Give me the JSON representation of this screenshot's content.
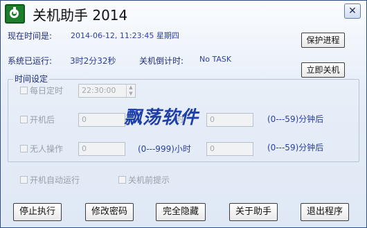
{
  "window": {
    "title": "关机助手 2014",
    "close_glyph": "✕"
  },
  "status": {
    "current_time_label": "现在时间是:",
    "current_time_value": "2014-06-12, 11:23:45  星期四",
    "uptime_label": "系统已运行:",
    "uptime_value": "3时2分32秒",
    "countdown_label": "关机倒计时:",
    "countdown_value": "No TASK"
  },
  "side_buttons": {
    "protect": "保护进程",
    "shutdown_now": "立即关机"
  },
  "time_settings": {
    "group_title": "时间设定",
    "daily": {
      "label": "每日定时",
      "value": "22:30:00"
    },
    "after": {
      "label": "开机后",
      "value": "0",
      "value2": "0",
      "range": "(0---59)分钟后"
    },
    "idle": {
      "label": "无人操作",
      "value": "0",
      "range": "(0---999)小时",
      "value2": "0",
      "range2": "(0---59)分钟后"
    },
    "hidden_hour_char": "时"
  },
  "options": {
    "autostart": "开机自动运行",
    "prompt": "关机前提示"
  },
  "watermark": "飘荡软件",
  "bottom_buttons": [
    "停止执行",
    "修改密码",
    "完全隐藏",
    "关于助手",
    "退出程序"
  ]
}
